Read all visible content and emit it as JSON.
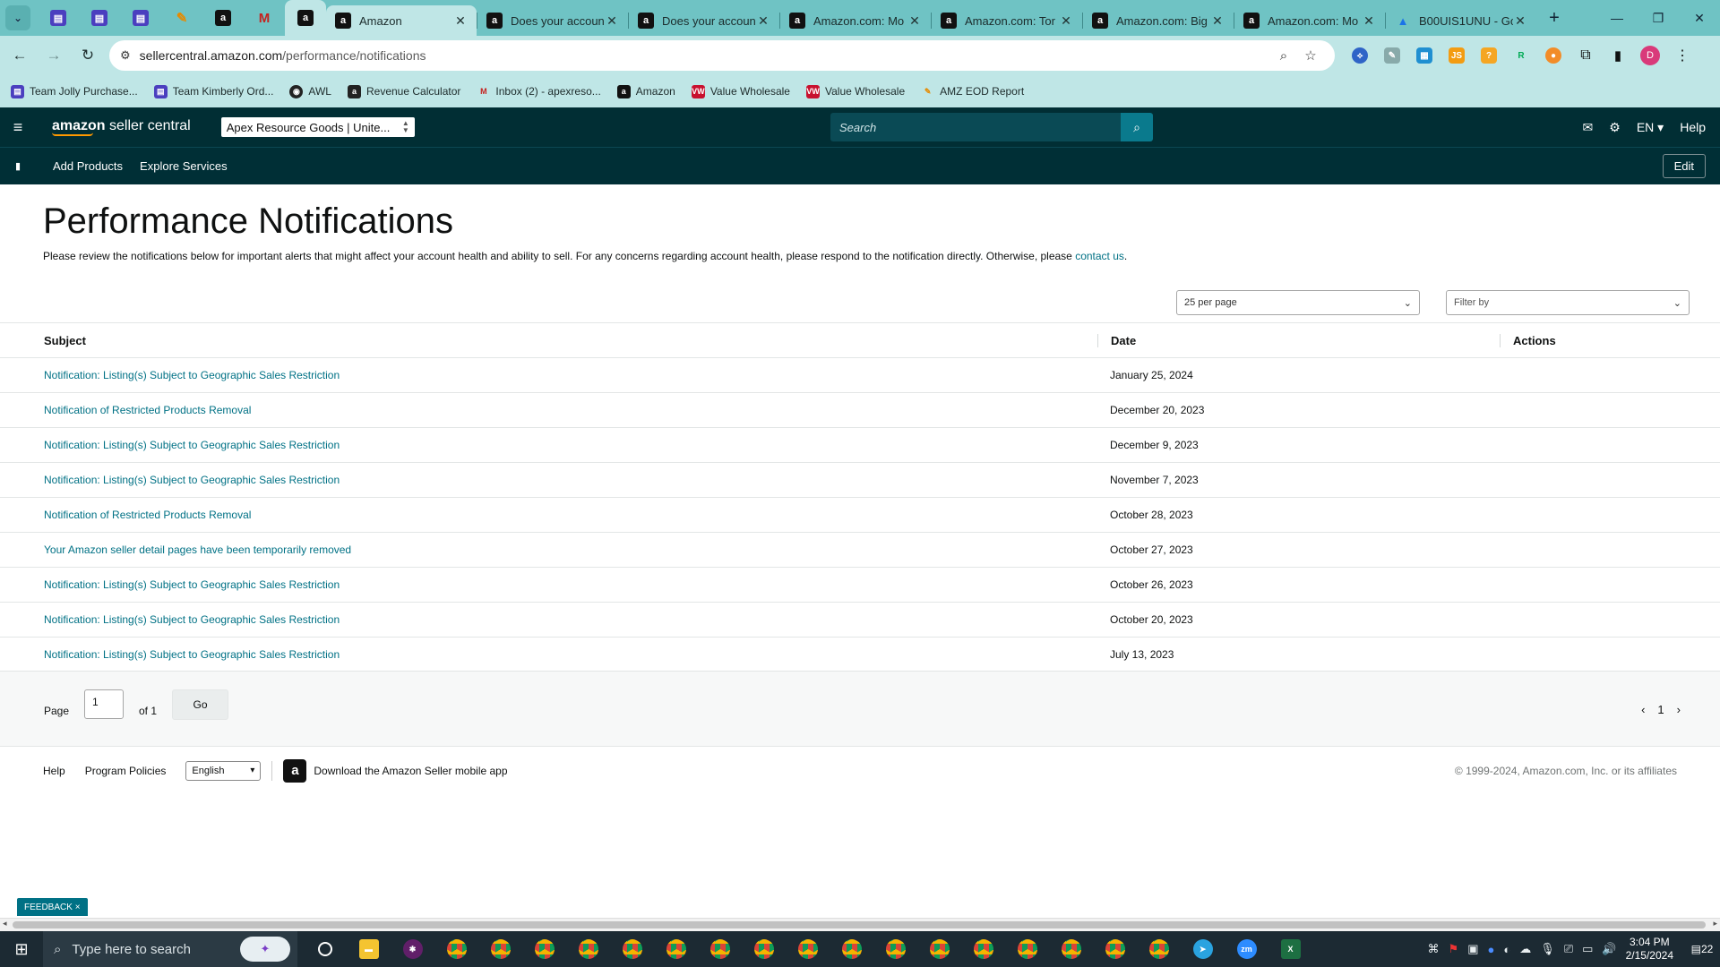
{
  "browser": {
    "pinned_tabs": [
      {
        "icon": "sheet-icon"
      },
      {
        "icon": "sheet-icon"
      },
      {
        "icon": "sheet-icon"
      },
      {
        "icon": "feather-icon"
      },
      {
        "icon": "amazon-icon"
      },
      {
        "icon": "gmail-icon"
      },
      {
        "icon": "amazon-icon"
      }
    ],
    "tabs": [
      {
        "label": "Amazon",
        "icon": "amazon-icon",
        "active": true
      },
      {
        "label": "Does your accoun",
        "icon": "amazon-icon"
      },
      {
        "label": "Does your accoun",
        "icon": "amazon-icon"
      },
      {
        "label": "Amazon.com: Mo",
        "icon": "amazon-icon"
      },
      {
        "label": "Amazon.com: Tor",
        "icon": "amazon-icon"
      },
      {
        "label": "Amazon.com: Big",
        "icon": "amazon-icon"
      },
      {
        "label": "Amazon.com: Mo",
        "icon": "amazon-icon"
      },
      {
        "label": "B00UIS1UNU - Go",
        "icon": "drive-icon"
      }
    ],
    "url_host": "sellercentral.amazon.com",
    "url_path": "/performance/notifications",
    "profile_initial": "D",
    "bookmarks": [
      {
        "label": "Team Jolly Purchase...",
        "icon": "sheet-icon"
      },
      {
        "label": "Team Kimberly Ord...",
        "icon": "sheet-icon"
      },
      {
        "label": "AWL",
        "icon": "awl-icon"
      },
      {
        "label": "Revenue Calculator",
        "icon": "calculator-icon"
      },
      {
        "label": "Inbox (2) - apexreso...",
        "icon": "gmail-icon"
      },
      {
        "label": "Amazon",
        "icon": "amazon-icon"
      },
      {
        "label": "Value Wholesale",
        "icon": "vw-icon"
      },
      {
        "label": "Value Wholesale",
        "icon": "vw-icon"
      },
      {
        "label": "AMZ EOD Report",
        "icon": "feather-icon"
      }
    ]
  },
  "seller_central": {
    "logo_main": "amazon",
    "logo_sub": " seller central",
    "account": "Apex Resource Goods | Unite...",
    "search_placeholder": "Search",
    "language": "EN",
    "help": "Help",
    "nav": [
      "Add Products",
      "Explore Services"
    ],
    "edit": "Edit"
  },
  "page": {
    "title": "Performance Notifications",
    "description": "Please review the notifications below for important alerts that might affect your account health and ability to sell. For any concerns regarding account health, please respond to the notification directly. Otherwise, please ",
    "contact_link": "contact us",
    "description_end": ".",
    "per_page": "25 per page",
    "filter_placeholder": "Filter by",
    "columns": {
      "subject": "Subject",
      "date": "Date",
      "actions": "Actions"
    },
    "notifications": [
      {
        "subject": "Notification: Listing(s) Subject to Geographic Sales Restriction",
        "date": "January 25, 2024"
      },
      {
        "subject": "Notification of Restricted Products Removal",
        "date": "December 20, 2023"
      },
      {
        "subject": "Notification: Listing(s) Subject to Geographic Sales Restriction",
        "date": "December 9, 2023"
      },
      {
        "subject": "Notification: Listing(s) Subject to Geographic Sales Restriction",
        "date": "November 7, 2023"
      },
      {
        "subject": "Notification of Restricted Products Removal",
        "date": "October 28, 2023"
      },
      {
        "subject": "Your Amazon seller detail pages have been temporarily removed",
        "date": "October 27, 2023"
      },
      {
        "subject": "Notification: Listing(s) Subject to Geographic Sales Restriction",
        "date": "October 26, 2023"
      },
      {
        "subject": "Notification: Listing(s) Subject to Geographic Sales Restriction",
        "date": "October 20, 2023"
      },
      {
        "subject": "Notification: Listing(s) Subject to Geographic Sales Restriction",
        "date": "July 13, 2023"
      }
    ],
    "pager": {
      "page_label": "Page",
      "page_value": "1",
      "of_label": "of 1",
      "go": "Go",
      "current": "1"
    }
  },
  "footer": {
    "help": "Help",
    "policies": "Program Policies",
    "language": "English",
    "app": "Download the Amazon Seller mobile app",
    "copyright": "© 1999-2024, Amazon.com, Inc. or its affiliates"
  },
  "feedback": "FEEDBACK",
  "taskbar": {
    "search_placeholder": "Type here to search",
    "time": "3:04 PM",
    "date": "2/15/2024",
    "notifications": "22"
  }
}
